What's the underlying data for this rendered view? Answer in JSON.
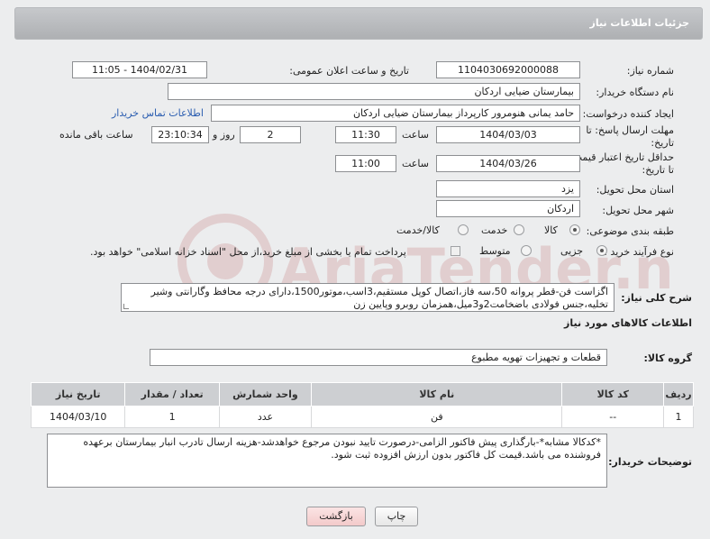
{
  "header": {
    "title": "جزئیات اطلاعات نیاز"
  },
  "fields": {
    "need_number_label": "شماره نیاز:",
    "need_number": "1104030692000088",
    "announce_label": "تاریخ و ساعت اعلان عمومی:",
    "announce_value": "1404/02/31 - 11:05",
    "buyer_org_label": "نام دستگاه خریدار:",
    "buyer_org": "بیمارستان ضیایی اردکان",
    "requester_label": "ایجاد کننده درخواست:",
    "requester": "حامد یمانی هنومرور کارپرداز بیمارستان ضیایی اردکان",
    "contact_link": "اطلاعات تماس خریدار",
    "reply_deadline_label_1": "مهلت ارسال پاسخ: تا",
    "reply_deadline_label_2": "تاریخ:",
    "reply_date": "1404/03/03",
    "time_label": "ساعت",
    "reply_time": "11:30",
    "days_value": "2",
    "days_label": "روز و",
    "remaining_time": "23:10:34",
    "remaining_label": "ساعت باقی مانده",
    "price_validity_label_1": "حداقل تاریخ اعتبار قیمت:",
    "price_validity_label_2": "تا تاریخ:",
    "price_date": "1404/03/26",
    "price_time": "11:00",
    "province_label": "استان محل تحویل:",
    "province": "یزد",
    "city_label": "شهر محل تحویل:",
    "city": "اردکان",
    "category_label": "طبقه بندی موضوعی:",
    "category_options": [
      "کالا",
      "خدمت",
      "کالا/خدمت"
    ],
    "process_label": "نوع فرآیند خرید :",
    "process_options": [
      "جزیی",
      "متوسط"
    ],
    "payment_note": "پرداخت تمام یا بخشی از مبلغ خرید،از محل \"اسناد خزانه اسلامی\" خواهد بود."
  },
  "description": {
    "label": "شرح کلی نیاز:",
    "text": "اگزاست فن-قطر پروانه 50،سه فاز،اتصال کوپل مستقیم،3اسب،موتور1500،دارای درجه محافظ وگارانتی وشیر تخلیه،جنس فولادی باضخامت2و3میل،همزمان روبرو وپایین زن"
  },
  "goods": {
    "section_title": "اطلاعات کالاهای مورد نیاز",
    "group_label": "گروه کالا:",
    "group_value": "قطعات و تجهیزات تهویه مطبوع",
    "columns": [
      "ردیف",
      "کد کالا",
      "نام کالا",
      "واحد شمارش",
      "تعداد / مقدار",
      "تاریخ نیاز"
    ],
    "rows": [
      [
        "1",
        "--",
        "فن",
        "عدد",
        "1",
        "1404/03/10"
      ]
    ]
  },
  "buyer_notes": {
    "label": "توضیحات خریدار:",
    "text": "*کدکالا مشابه*-بارگذاری پیش فاکتور الزامی-درصورت تایید نبودن مرجوع خواهدشد-هزینه ارسال تادرب انبار بیمارستان برعهده فروشنده می باشد.قیمت کل فاکتور بدون ارزش افزوده ثبت شود."
  },
  "buttons": {
    "print": "چاپ",
    "back": "بازگشت"
  },
  "watermark": {
    "text": "AriaTender.neT"
  },
  "colors": {
    "header_bg": "#b3b5b8",
    "link": "#2a5db0",
    "back_button_bg": "#f8d7d7"
  }
}
